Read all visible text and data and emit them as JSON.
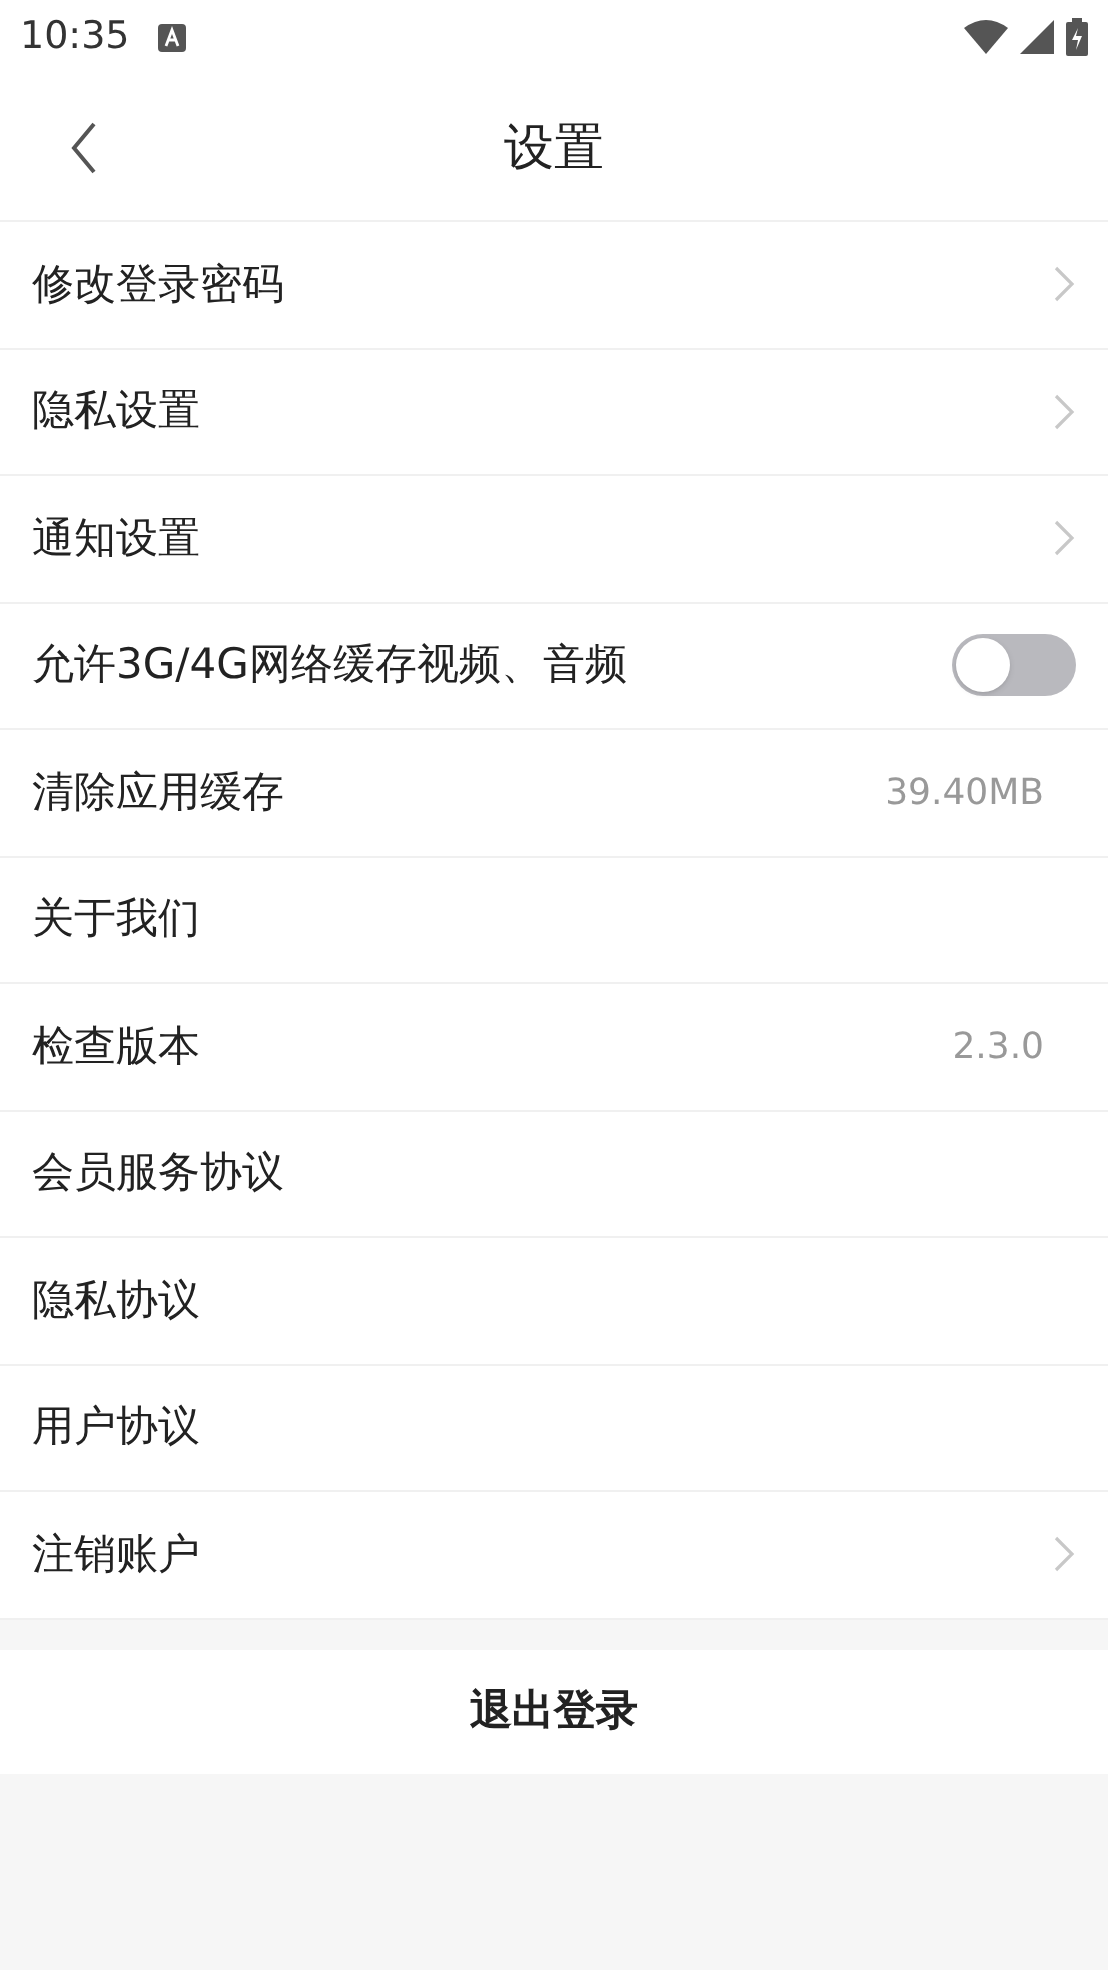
{
  "status_bar": {
    "time": "10:35"
  },
  "header": {
    "title": "设置"
  },
  "items": [
    {
      "label": "修改登录密码",
      "kind": "arrow"
    },
    {
      "label": "隐私设置",
      "kind": "arrow"
    },
    {
      "label": "通知设置",
      "kind": "arrow"
    },
    {
      "label": "允许3G/4G网络缓存视频、音频",
      "kind": "toggle",
      "on": false
    },
    {
      "label": "清除应用缓存",
      "kind": "value",
      "value": "39.40MB"
    },
    {
      "label": "关于我们",
      "kind": "plain"
    },
    {
      "label": "检查版本",
      "kind": "value",
      "value": "2.3.0"
    },
    {
      "label": "会员服务协议",
      "kind": "plain"
    },
    {
      "label": "隐私协议",
      "kind": "plain"
    },
    {
      "label": "用户协议",
      "kind": "plain"
    },
    {
      "label": "注销账户",
      "kind": "arrow"
    }
  ],
  "logout_button": "退出登录"
}
